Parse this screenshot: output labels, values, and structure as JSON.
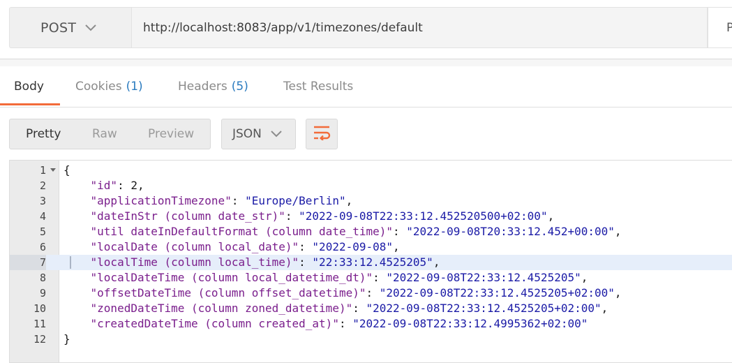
{
  "request": {
    "method": "POST",
    "url": "http://localhost:8083/app/v1/timezones/default",
    "params_label": "P"
  },
  "response_tabs": [
    {
      "label": "Body",
      "count": ""
    },
    {
      "label": "Cookies",
      "count": "(1)"
    },
    {
      "label": "Headers",
      "count": "(5)"
    },
    {
      "label": "Test Results",
      "count": ""
    }
  ],
  "view_modes": [
    "Pretty",
    "Raw",
    "Preview"
  ],
  "format": "JSON",
  "icons": {
    "method_dropdown": "chevron-down-icon",
    "format_dropdown": "chevron-down-icon",
    "wrap": "wrap-lines-icon",
    "fold": "fold-arrow-icon"
  },
  "colors": {
    "accent": "#f26b3a",
    "key": "#7a1e8c",
    "string": "#1a1aa6",
    "count": "#2b7bbf",
    "highlight_line": "#e6eefa"
  },
  "editor": {
    "active_line": 7,
    "lines": [
      {
        "num": "1",
        "parts": [
          {
            "t": "p",
            "v": "{"
          }
        ]
      },
      {
        "num": "2",
        "parts": [
          {
            "t": "k",
            "v": "    \"id\""
          },
          {
            "t": "p",
            "v": ": "
          },
          {
            "t": "n",
            "v": "2"
          },
          {
            "t": "p",
            "v": ","
          }
        ]
      },
      {
        "num": "3",
        "parts": [
          {
            "t": "k",
            "v": "    \"applicationTimezone\""
          },
          {
            "t": "p",
            "v": ": "
          },
          {
            "t": "s",
            "v": "\"Europe/Berlin\""
          },
          {
            "t": "p",
            "v": ","
          }
        ]
      },
      {
        "num": "4",
        "parts": [
          {
            "t": "k",
            "v": "    \"dateInStr (column date_str)\""
          },
          {
            "t": "p",
            "v": ": "
          },
          {
            "t": "s",
            "v": "\"2022-09-08T22:33:12.452520500+02:00\""
          },
          {
            "t": "p",
            "v": ","
          }
        ]
      },
      {
        "num": "5",
        "parts": [
          {
            "t": "k",
            "v": "    \"util dateInDefaultFormat (column date_time)\""
          },
          {
            "t": "p",
            "v": ": "
          },
          {
            "t": "s",
            "v": "\"2022-09-08T20:33:12.452+00:00\""
          },
          {
            "t": "p",
            "v": ","
          }
        ]
      },
      {
        "num": "6",
        "parts": [
          {
            "t": "k",
            "v": "    \"localDate (column local_date)\""
          },
          {
            "t": "p",
            "v": ": "
          },
          {
            "t": "s",
            "v": "\"2022-09-08\""
          },
          {
            "t": "p",
            "v": ","
          }
        ]
      },
      {
        "num": "7",
        "parts": [
          {
            "t": "k",
            "v": "    \"localTime (column local_time)\""
          },
          {
            "t": "p",
            "v": ": "
          },
          {
            "t": "s",
            "v": "\"22:33:12.4525205\""
          },
          {
            "t": "p",
            "v": ","
          }
        ]
      },
      {
        "num": "8",
        "parts": [
          {
            "t": "k",
            "v": "    \"localDateTime (column local_datetime_dt)\""
          },
          {
            "t": "p",
            "v": ": "
          },
          {
            "t": "s",
            "v": "\"2022-09-08T22:33:12.4525205\""
          },
          {
            "t": "p",
            "v": ","
          }
        ]
      },
      {
        "num": "9",
        "parts": [
          {
            "t": "k",
            "v": "    \"offsetDateTime (column offset_datetime)\""
          },
          {
            "t": "p",
            "v": ": "
          },
          {
            "t": "s",
            "v": "\"2022-09-08T22:33:12.4525205+02:00\""
          },
          {
            "t": "p",
            "v": ","
          }
        ]
      },
      {
        "num": "10",
        "parts": [
          {
            "t": "k",
            "v": "    \"zonedDateTime (column zoned_datetime)\""
          },
          {
            "t": "p",
            "v": ": "
          },
          {
            "t": "s",
            "v": "\"2022-09-08T22:33:12.4525205+02:00\""
          },
          {
            "t": "p",
            "v": ","
          }
        ]
      },
      {
        "num": "11",
        "parts": [
          {
            "t": "k",
            "v": "    \"createdDateTime (column created_at)\""
          },
          {
            "t": "p",
            "v": ": "
          },
          {
            "t": "s",
            "v": "\"2022-09-08T22:33:12.4995362+02:00\""
          }
        ]
      },
      {
        "num": "12",
        "parts": [
          {
            "t": "p",
            "v": "}"
          }
        ]
      }
    ]
  }
}
